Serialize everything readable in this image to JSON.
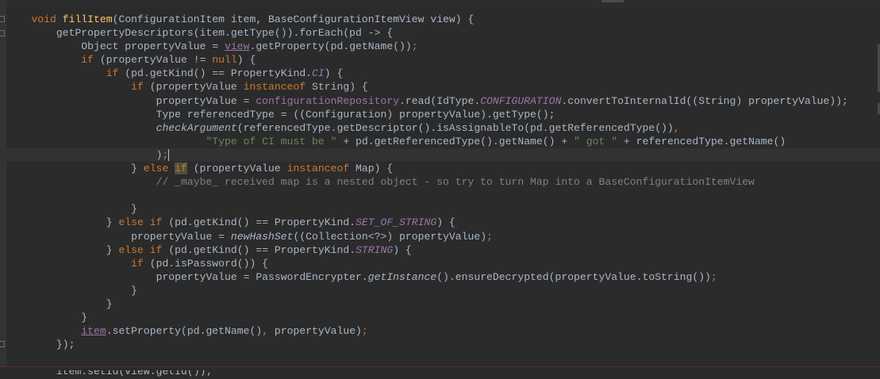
{
  "editor": {
    "theme": "darcula",
    "colors": {
      "background": "#2b2b2b",
      "default": "#a9b7c6",
      "keyword": "#cc7832",
      "method_declaration": "#ffc66d",
      "string": "#6a8759",
      "comment": "#808080",
      "constant": "#9876aa",
      "caret_row": "#323232"
    },
    "lines": [
      "void fillItem(ConfigurationItem item, BaseConfigurationItemView view) {",
      "getPropertyDescriptors(item.getType()).forEach(pd -> {",
      "Object propertyValue = view.getProperty(pd.getName());",
      "if (propertyValue != null) {",
      "if (pd.getKind() == PropertyKind.CI) {",
      "if (propertyValue instanceof String) {",
      "propertyValue = configurationRepository.read(IdType.CONFIGURATION.convertToInternalId((String) propertyValue));",
      "Type referencedType = ((Configuration) propertyValue).getType();",
      "checkArgument(referencedType.getDescriptor().isAssignableTo(pd.getReferencedType()),",
      "\"Type of CI must be \" + pd.getReferencedType().getName() + \" got \" + referencedType.getName()",
      ");",
      "} else if (propertyValue instanceof Map) {",
      "// _maybe_ received map is a nested object - so try to turn Map into a BaseConfigurationItemView",
      "",
      "}",
      "} else if (pd.getKind() == PropertyKind.SET_OF_STRING) {",
      "propertyValue = newHashSet((Collection<?>) propertyValue);",
      "} else if (pd.getKind() == PropertyKind.STRING) {",
      "if (pd.isPassword()) {",
      "propertyValue = PasswordEncrypter.getInstance().ensureDecrypted(propertyValue.toString());",
      "}",
      "}",
      "}",
      "item.setProperty(pd.getName(), propertyValue);",
      "});",
      "",
      "item.setId(view.getId());"
    ],
    "tokens": {
      "void": "void",
      "fillItem": "fillItem",
      "params": "(ConfigurationItem item, BaseConfigurationItemView view) {",
      "getPropertyDescriptors": "getPropertyDescriptors(item.getType()).forEach(pd -> {",
      "object_decl": "Object propertyValue = ",
      "view": "view",
      "getProperty": ".getProperty(pd.getName())",
      "semicolon": ";",
      "if": "if",
      "cond_null_a": " (propertyValue != ",
      "null": "null",
      "cond_null_b": ") {",
      "getKind_a": " (pd.getKind() == PropertyKind.",
      "CI": "CI",
      "brace_open": ") {",
      "instanceof_a": " (propertyValue ",
      "instanceof": "instanceof",
      "string_open": " String) {",
      "read_a": "propertyValue = ",
      "configurationRepository": "configurationRepository",
      "read_b": ".read(IdType.",
      "CONFIGURATION": "CONFIGURATION",
      "read_c": ".convertToInternalId((String) propertyValue));",
      "type_line": "Type referencedType = ((Configuration) propertyValue).getType();",
      "checkArgument": "checkArgument",
      "check_rest": "(referencedType.getDescriptor().isAssignableTo(pd.getReferencedType())",
      "comma": ",",
      "str1": "\"Type of CI must be \"",
      "mid1": " + pd.getReferencedType().getName() + ",
      "str2": "\" got \"",
      "mid2": " + referencedType.getName()",
      "close_paren": ")",
      "close_brace": "} ",
      "else": "else",
      "map_open": " Map) {",
      "comment": "// _maybe_ received map is a nested object - so try to turn Map into a BaseConfigurationItemView",
      "brace": "}",
      "SET_OF_STRING": "SET_OF_STRING",
      "newHashSet": "newHashSet",
      "hashset_rest": "((Collection<?>) propertyValue)",
      "STRING": "STRING",
      "isPassword": " (pd.isPassword()) {",
      "encrypter_a": "propertyValue = PasswordEncrypter.",
      "getInstance": "getInstance",
      "encrypter_b": "().ensureDecrypted(propertyValue.toString())",
      "item": "item",
      "setProperty": ".setProperty(pd.getName()",
      "setProperty_b": " propertyValue)",
      "lambda_close": "});",
      "setId": "item.setId(view.getId());",
      "space": " "
    }
  }
}
